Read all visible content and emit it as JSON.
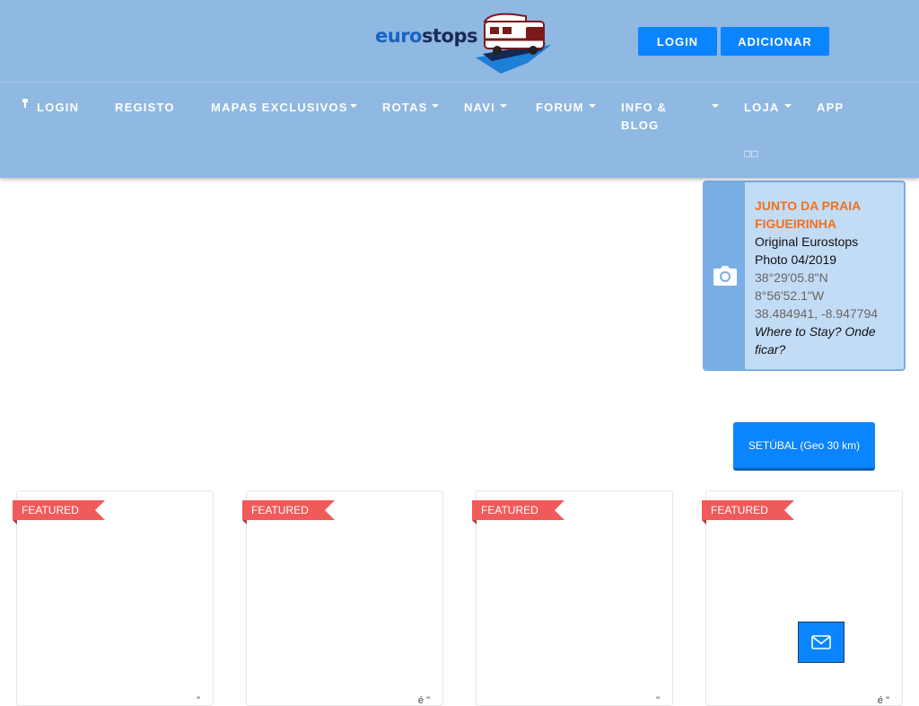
{
  "header": {
    "logo": {
      "part1": "euro",
      "part2": "stops"
    },
    "login_button": "LOGIN",
    "add_button": "ADICIONAR"
  },
  "nav": {
    "login": "LOGIN",
    "register": "REGISTO",
    "maps": "MAPAS EXCLUSIVOS",
    "routes": "ROTAS",
    "navi": "NAVI",
    "forum": "FORUM",
    "info_line1": "INFO &",
    "info_line2": "BLOG",
    "shop": "LOJA",
    "app": "APP",
    "extra": "□□"
  },
  "info_card": {
    "title_line1": "JUNTO DA PRAIA",
    "title_line2": "FIGUEIRINHA",
    "source": "Original Eurostops",
    "photo": "Photo 04/2019",
    "lat_dms": "38°29'05.8\"N",
    "lon_dms": "8°56'52.1\"W",
    "decimal": "38.484941, -8.947794",
    "question": "Where to Stay? Onde ficar?",
    "icon": "camera-icon"
  },
  "region_button": "SETÚBAL (Geo 30 km)",
  "featured_cards": [
    {
      "badge": "FEATURED",
      "marks": "\""
    },
    {
      "badge": "FEATURED",
      "marks": "é \""
    },
    {
      "badge": "FEATURED",
      "marks": "\""
    },
    {
      "badge": "FEATURED",
      "marks": "é \""
    }
  ],
  "colors": {
    "header_bg": "#8fb8e2",
    "accent_blue": "#0a84ff",
    "card_title": "#f0701a",
    "ribbon": "#f05a5a"
  }
}
